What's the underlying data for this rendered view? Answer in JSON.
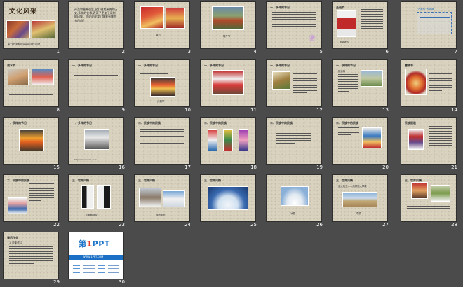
{
  "view": "slide-sorter",
  "slides": [
    {
      "num": "1",
      "title": "文化风采",
      "caption": "第一PPT模板网-WWW.1PPT.COM"
    },
    {
      "num": "2",
      "text": "孙浩和墨来也生,它们借其亲统的历史,多样的艺术,表演了更加了深刻的印象。你说说说我们城来有哪些节日吗?"
    },
    {
      "num": "3",
      "caption": "春节"
    },
    {
      "num": "4",
      "caption": "端午节"
    },
    {
      "num": "5",
      "head": "一、多样的节日",
      "flower": "❀"
    },
    {
      "num": "6",
      "head": "圣诞节",
      "caption": "圣诞老人"
    },
    {
      "num": "7",
      "head": "\"古老的\"的阅读",
      "caption": "阅读"
    },
    {
      "num": "8",
      "head": "泼水节"
    },
    {
      "num": "9",
      "head": "一、多样的节日"
    },
    {
      "num": "10",
      "head": "一、多样的节日",
      "caption": "火把节"
    },
    {
      "num": "11",
      "head": "一、多样的节日"
    },
    {
      "num": "12",
      "head": "一、多样的节日"
    },
    {
      "num": "13",
      "head": "一、多样的节日",
      "sub": "那达慕"
    },
    {
      "num": "14",
      "head": "雪顿节"
    },
    {
      "num": "15",
      "head": "一、多样的节日"
    },
    {
      "num": "16",
      "head": "一、多样的节日",
      "caption": "http://www.xxxx.com"
    },
    {
      "num": "17",
      "head": "二、民族中的民族"
    },
    {
      "num": "18",
      "head": "二、民族中的民族"
    },
    {
      "num": "19",
      "head": "二、民族中的民族"
    },
    {
      "num": "20",
      "head": "二、民族中的民族"
    },
    {
      "num": "21",
      "head": "民族服装"
    },
    {
      "num": "22",
      "head": "二、民族中的民族"
    },
    {
      "num": "23",
      "head": "三、世界风情",
      "caption": "企鹅和朋友"
    },
    {
      "num": "24",
      "head": "三、世界风情",
      "caption": "极地风光"
    },
    {
      "num": "25",
      "head": "三、世界风情"
    },
    {
      "num": "26",
      "caption": "冰屋"
    },
    {
      "num": "27",
      "head": "三、世界风情",
      "sub": "澳大利亚——热带的大草原",
      "caption": "草原"
    },
    {
      "num": "28",
      "head": "三、世界风情"
    },
    {
      "num": "29",
      "head": "课后作业",
      "sub": "1. 收集资料"
    },
    {
      "num": "30",
      "logo": "第1PPT",
      "logo_accent": "1",
      "tagline": "WWW.1PPT.COM"
    }
  ],
  "colors": {
    "background": "#4b4b4b",
    "slide": "#d8d2bf",
    "accent_blue": "#1b6fc4",
    "title_brown": "#3a2a1a"
  }
}
